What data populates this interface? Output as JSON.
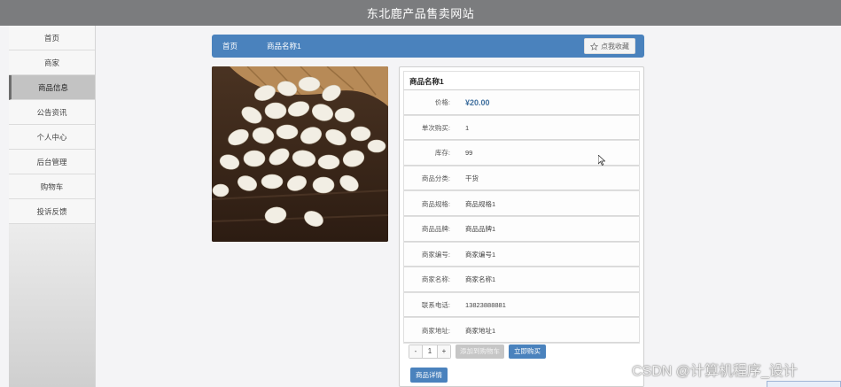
{
  "header": {
    "title": "东北鹿产品售卖网站"
  },
  "sidebar": {
    "items": [
      {
        "label": "首页"
      },
      {
        "label": "商家"
      },
      {
        "label": "商品信息"
      },
      {
        "label": "公告资讯"
      },
      {
        "label": "个人中心"
      },
      {
        "label": "后台管理"
      },
      {
        "label": "购物车"
      },
      {
        "label": "投诉反馈"
      }
    ],
    "active_index": 2
  },
  "breadcrumb": {
    "home": "首页",
    "current": "商品名称1",
    "favorite": "点我收藏"
  },
  "product": {
    "title": "商品名称1",
    "rows": [
      {
        "label": "价格:",
        "value": "¥20.00"
      },
      {
        "label": "单次购买:",
        "value": "1"
      },
      {
        "label": "库存:",
        "value": "99"
      },
      {
        "label": "商品分类:",
        "value": "干货"
      },
      {
        "label": "商品规格:",
        "value": "商品规格1"
      },
      {
        "label": "商品品牌:",
        "value": "商品品牌1"
      },
      {
        "label": "商家编号:",
        "value": "商家编号1"
      },
      {
        "label": "商家名称:",
        "value": "商家名称1"
      },
      {
        "label": "联系电话:",
        "value": "13823888881"
      },
      {
        "label": "商家地址:",
        "value": "商家地址1"
      }
    ],
    "quantity": {
      "minus": "-",
      "value": "1",
      "plus": "+"
    },
    "add_to_cart": "添加到购物车",
    "buy_now": "立即购买",
    "detail": "商品详情"
  },
  "watermark": "CSDN @计算机程序_设计",
  "colors": {
    "accent": "#4a82bd",
    "topbar": "#7b7c7e"
  },
  "icons": {
    "favorite": "star-outline-icon",
    "cursor": "mouse-pointer-icon"
  }
}
